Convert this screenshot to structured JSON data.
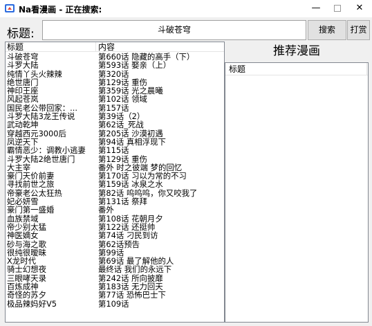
{
  "window": {
    "title": "Na看漫画 - 正在搜索:",
    "minimize_glyph": "—",
    "close_glyph": "✕",
    "icon": "app-icon"
  },
  "search": {
    "label": "标题:",
    "value": "斗破苍穹",
    "search_button": "搜索",
    "reward_button": "打赏"
  },
  "results": {
    "headers": [
      "标题",
      "内容"
    ],
    "rows": [
      [
        "斗破苍穹",
        "第660话 隐藏的高手（下）"
      ],
      [
        "斗罗大陆",
        "第593话 娶亲（上）"
      ],
      [
        "纯情丫头火辣辣",
        "第320话"
      ],
      [
        "绝世唐门",
        "第129话 重伤"
      ],
      [
        "神印王座",
        "第359话 光之晨曦"
      ],
      [
        "风起苍岚",
        "第102话 领域"
      ],
      [
        "国民老公带回家：...",
        "第157话"
      ],
      [
        "斗罗大陆3龙王传说",
        "第39话（2）"
      ],
      [
        "武动乾坤",
        "第62话_死战"
      ],
      [
        "穿越西元3000后",
        "第205话 沙漠初遇"
      ],
      [
        "凤逆天下",
        "第94话 真相浮现下"
      ],
      [
        "霸情恶少：调教小逃妻",
        "第115话"
      ],
      [
        "斗罗大陆2绝世唐门",
        "第129话 重伤"
      ],
      [
        "大主宰",
        "番外 时之彼端 梦的回忆"
      ],
      [
        "豪门天价前妻",
        "第170话 习以为常的不习"
      ],
      [
        "寻找前世之旅",
        "第159话 冰泉之水"
      ],
      [
        "帝豪老公太狂热",
        "第82话 呜呜呜，你又咬我了"
      ],
      [
        "妃必妍雪",
        "第131话 祭拜"
      ],
      [
        "豪门第一盛婚",
        "番外"
      ],
      [
        "血族禁域",
        "第108话 花朝月夕"
      ],
      [
        "帝少别太猛",
        "第122话 还挺帅"
      ],
      [
        "神医嫡女",
        "第74话 刁民到访"
      ],
      [
        "砂与海之歌",
        "第62话预告"
      ],
      [
        "很纯很暧昧",
        "第99话"
      ],
      [
        "X龙时代",
        "第69话 最了解他的人"
      ],
      [
        "骑士幻想夜",
        "最终话 我们的永远下"
      ],
      [
        "三眼哮天录",
        "第242话 所向披靡"
      ],
      [
        "百炼成神",
        "第183话 无力回天"
      ],
      [
        "奇怪的苏夕",
        "第77话 恐怖巴士下"
      ],
      [
        "极品辣妈好V5",
        "第109话"
      ]
    ]
  },
  "recommend": {
    "title": "推荐漫画",
    "header": "标题"
  }
}
